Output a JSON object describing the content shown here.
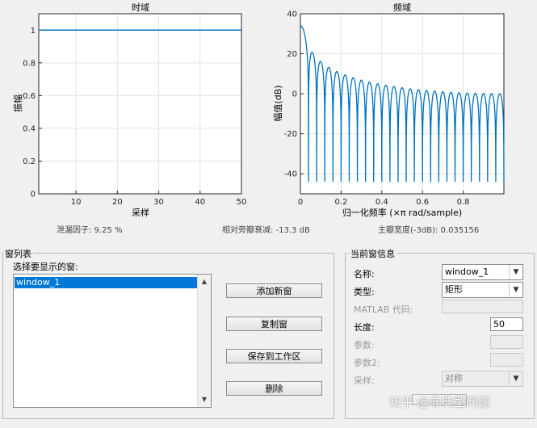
{
  "colors": {
    "line": "#0072bd",
    "selection": "#0078d7"
  },
  "time_plot": {
    "title": "时域",
    "xlabel": "采样",
    "ylabel": "振幅"
  },
  "freq_plot": {
    "title": "频域",
    "xlabel": "归一化频率 (×π rad/sample)",
    "ylabel": "幅值(dB)"
  },
  "chart_data": [
    {
      "type": "line",
      "title": "时域",
      "xlabel": "采样",
      "ylabel": "振幅",
      "xlim": [
        1,
        50
      ],
      "ylim": [
        0,
        1.1
      ],
      "xticks": [
        10,
        20,
        30,
        40,
        50
      ],
      "yticks": [
        0,
        0.2,
        0.4,
        0.6,
        0.8,
        1
      ],
      "grid": true,
      "series": [
        {
          "x": [
            1,
            50
          ],
          "y": [
            1,
            1
          ]
        }
      ]
    },
    {
      "type": "line",
      "title": "频域",
      "xlabel": "归一化频率 (×π rad/sample)",
      "ylabel": "幅值(dB)",
      "xlim": [
        0,
        1
      ],
      "ylim": [
        -50,
        40
      ],
      "xticks": [
        0,
        0.2,
        0.4,
        0.6,
        0.8
      ],
      "yticks": [
        -40,
        -20,
        0,
        20,
        40
      ],
      "grid": true,
      "window_length": 50,
      "series": [
        {
          "description": "DC peak ≈ 34 dB, first sidelobe ≈ 21 dB, sidelobes decay toward ≈ 0 dB with deep nulls every 0.04"
        }
      ]
    }
  ],
  "stats": {
    "leakage": "泄漏因子: 9.25 %",
    "sidelobe": "相对旁瓣衰减: -13.3 dB",
    "mainlobe": "主瓣宽度(-3dB): 0.035156"
  },
  "window_list": {
    "title": "窗列表",
    "prompt": "选择要显示的窗:",
    "items": [
      "window_1"
    ],
    "buttons": {
      "add": "添加新窗",
      "copy": "复制窗",
      "save": "保存到工作区",
      "delete": "删除"
    }
  },
  "current_window": {
    "title": "当前窗信息",
    "name_label": "名称:",
    "name_value": "window_1",
    "type_label": "类型:",
    "type_value": "矩形",
    "matlab_label": "MATLAB 代码:",
    "length_label": "长度:",
    "length_value": "50",
    "param_label": "参数:",
    "param2_label": "参数2:",
    "sampling_label": "采样:",
    "sampling_value": "对称"
  },
  "watermark": "知乎 @非典型问题"
}
